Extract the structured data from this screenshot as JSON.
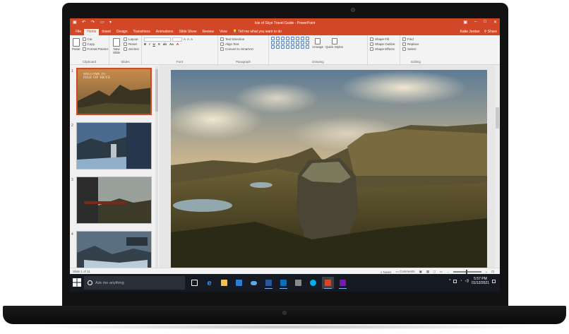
{
  "app": {
    "document_title": "Isle of Skye Travel Guide - PowerPoint",
    "user_name": "Katie Jordan",
    "share_label": "Share",
    "tell_me": "Tell me what you want to do"
  },
  "ribbon_tabs": [
    "File",
    "Home",
    "Insert",
    "Design",
    "Transitions",
    "Animations",
    "Slide Show",
    "Review",
    "View"
  ],
  "ribbon": {
    "clipboard": {
      "paste": "Paste",
      "cut": "Cut",
      "copy": "Copy",
      "format_painter": "Format Painter",
      "label": "Clipboard"
    },
    "slides": {
      "new_slide": "New Slide",
      "layout": "Layout",
      "reset": "Reset",
      "section": "Section",
      "label": "Slides"
    },
    "font": {
      "label": "Font"
    },
    "paragraph": {
      "text_direction": "Text Direction",
      "align_text": "Align Text",
      "convert_smartart": "Convert to SmartArt",
      "label": "Paragraph"
    },
    "drawing": {
      "arrange": "Arrange",
      "quick_styles": "Quick Styles",
      "shape_fill": "Shape Fill",
      "shape_outline": "Shape Outline",
      "shape_effects": "Shape Effects",
      "label": "Drawing"
    },
    "editing": {
      "find": "Find",
      "replace": "Replace",
      "select": "Select",
      "label": "Editing"
    }
  },
  "slides": [
    {
      "number": "1",
      "title": "ISLE OF SKYE",
      "subtitle": "WELCOME TO"
    },
    {
      "number": "2"
    },
    {
      "number": "3"
    },
    {
      "number": "4"
    }
  ],
  "status": {
    "slide_info": "Slide 1 of 11",
    "notes": "Notes",
    "comments": "Comments"
  },
  "taskbar": {
    "search_placeholder": "Ask me anything",
    "time": "5:57 PM",
    "date": "01/12/2021"
  },
  "colors": {
    "powerpoint_accent": "#d24726",
    "taskbar": "#151a22"
  }
}
